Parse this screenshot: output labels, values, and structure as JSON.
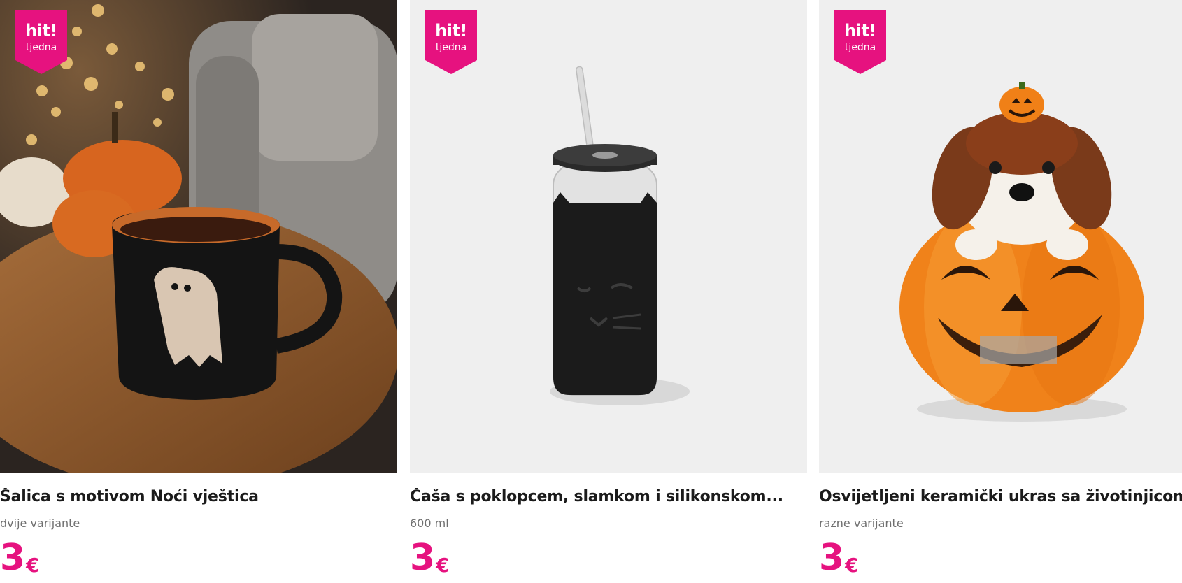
{
  "products": [
    {
      "badge_line1": "hit!",
      "badge_line2": "tjedna",
      "title": "Šalica s motivom Noći vještica",
      "subtitle": "dvije varijante",
      "price": "3",
      "currency": "€"
    },
    {
      "badge_line1": "hit!",
      "badge_line2": "tjedna",
      "title": "Čaša s poklopcem, slamkom i silikonskom...",
      "subtitle": "600 ml",
      "price": "3",
      "currency": "€"
    },
    {
      "badge_line1": "hit!",
      "badge_line2": "tjedna",
      "title": "Osvijetljeni keramički ukras sa životinjicom u...",
      "subtitle": "razne varijante",
      "price": "3",
      "currency": "€"
    }
  ],
  "colors": {
    "badge": "#e6127f",
    "price": "#e6127f",
    "title": "#1b1b1b",
    "subtitle": "#6f6f6f"
  }
}
